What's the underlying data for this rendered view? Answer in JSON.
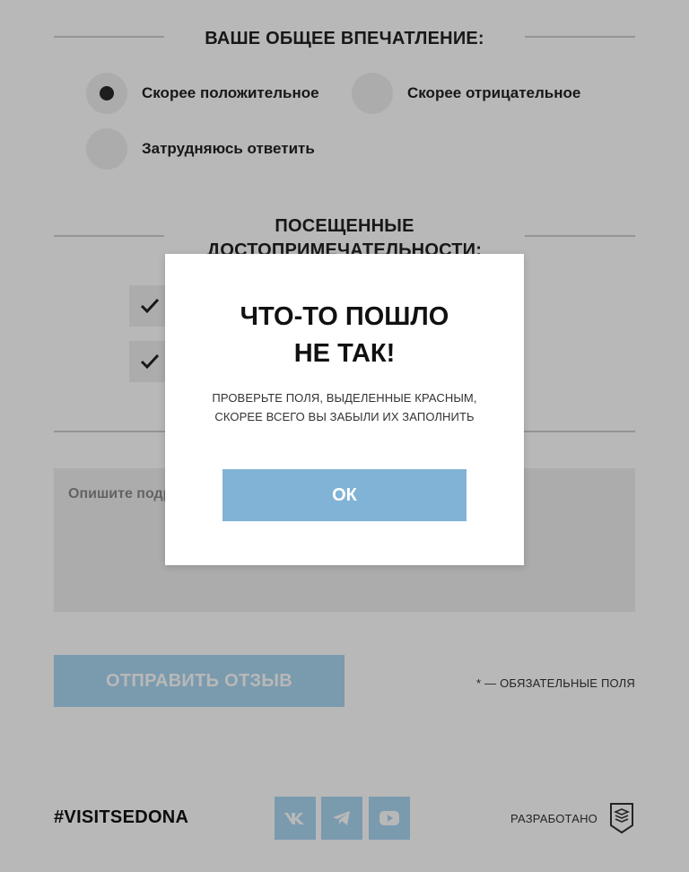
{
  "impression": {
    "title": "ВАШЕ ОБЩЕЕ ВПЕЧАТЛЕНИЕ:",
    "options": [
      {
        "label": "Скорее положительное",
        "selected": true
      },
      {
        "label": "Скорее отрицательное",
        "selected": false
      },
      {
        "label": "Затрудняюсь ответить",
        "selected": false
      }
    ]
  },
  "attractions": {
    "title_line1": "ПОСЕЩЕННЫЕ",
    "title_line2": "ДОСТОПРИМЕЧАТЕЛЬНОСТИ:",
    "checkboxes": [
      {
        "checked": true
      },
      {
        "checked": true
      }
    ]
  },
  "details": {
    "placeholder": "Опишите подр"
  },
  "submit_label": "ОТПРАВИТЬ ОТЗЫВ",
  "required_note": "* — ОБЯЗАТЕЛЬНЫЕ ПОЛЯ",
  "footer": {
    "hashtag": "#VISITSEDONA",
    "social": [
      {
        "icon": "vk-icon"
      },
      {
        "icon": "telegram-icon"
      },
      {
        "icon": "youtube-icon"
      }
    ],
    "developed_by": "РАЗРАБОТАНО",
    "dev_logo_icon": "shield-logo-icon"
  },
  "modal": {
    "title_line1": "ЧТО-ТО ПОШЛО",
    "title_line2": "НЕ ТАК!",
    "message_line1": "ПРОВЕРЬТЕ ПОЛЯ, ВЫДЕЛЕННЫЕ КРАСНЫМ,",
    "message_line2": "СКОРЕЕ ВСЕГО ВЫ ЗАБЫЛИ ИХ ЗАПОЛНИТЬ",
    "ok_label": "ОК"
  },
  "colors": {
    "accent": "#a9d6f2",
    "modal_button": "#80b3d5",
    "field_bg": "#efefef"
  }
}
